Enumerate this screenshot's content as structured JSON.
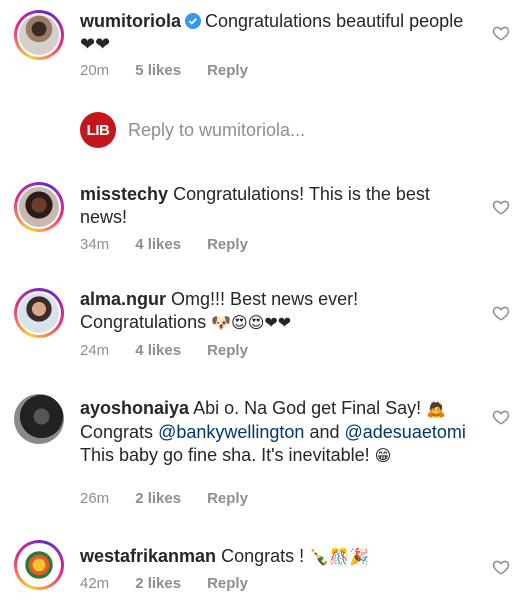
{
  "comments": [
    {
      "username": "wumitoriola",
      "verified": true,
      "text": "Congratulations beautiful people❤❤",
      "time": "20m",
      "likes": "5 likes",
      "reply": "Reply"
    },
    {
      "username": "misstechy",
      "text": "Congratulations! This is the best news!",
      "time": "34m",
      "likes": "4 likes",
      "reply": "Reply"
    },
    {
      "username": "alma.ngur",
      "text_prefix": "Omg!!! Best news ever!",
      "text_line2": "Congratulations",
      "emojis": "🐶😍😍❤❤",
      "time": "24m",
      "likes": "4 likes",
      "reply": "Reply"
    },
    {
      "username": "ayoshonaiya",
      "text_a": "Abi o. Na God get Final Say!",
      "emoji_a": "🙇",
      "text_b": "Congrats",
      "mention_1": "@bankywellington",
      "text_c": "and",
      "mention_2": "@adesuaetomi",
      "text_d": "This baby go fine sha. It's inevitable!",
      "emoji_d": "😁",
      "time": "26m",
      "likes": "2 likes",
      "reply": "Reply"
    },
    {
      "username": "westafrikanman",
      "text": "Congrats !",
      "emojis": "🍾🎊🎉",
      "time": "42m",
      "likes": "2 likes",
      "reply": "Reply"
    }
  ],
  "reply_field": {
    "logo_text": "LIB",
    "placeholder": "Reply to wumitoriola..."
  }
}
